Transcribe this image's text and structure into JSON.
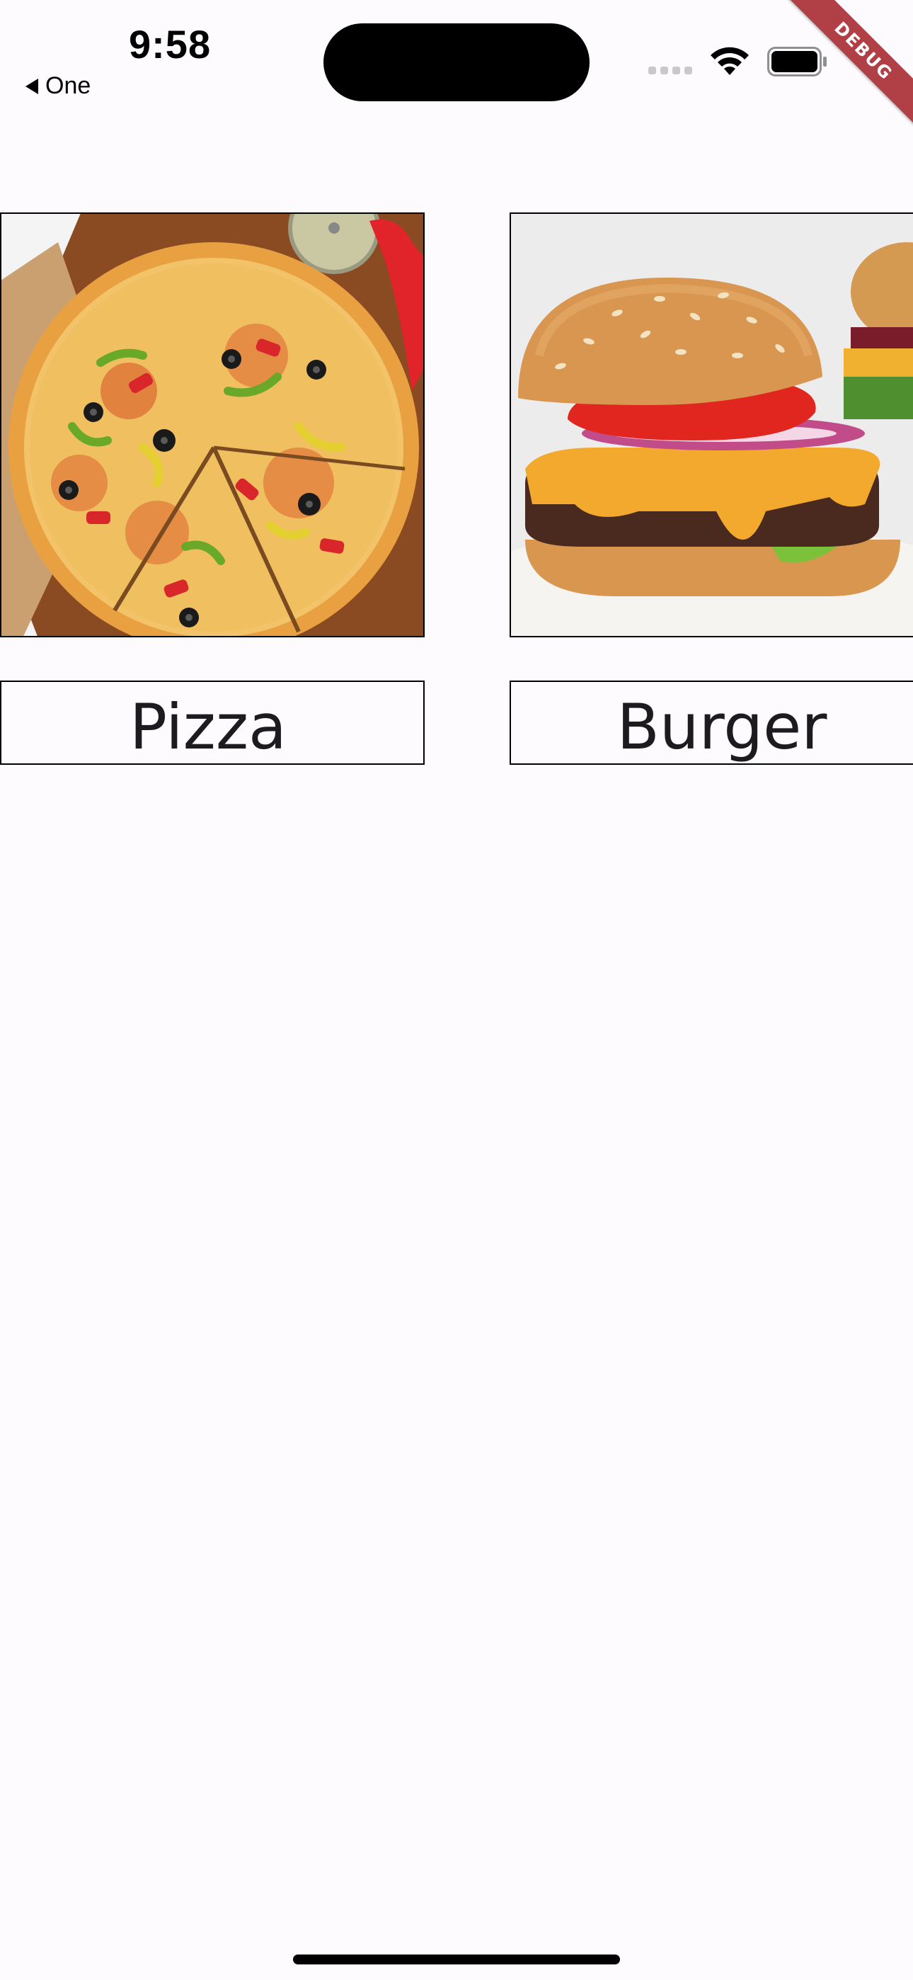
{
  "status_bar": {
    "time": "9:58",
    "back_label": "One"
  },
  "debug_banner": {
    "text": "DEBUG",
    "color": "#b13f46"
  },
  "foods": [
    {
      "label": "Pizza",
      "image": "pizza-photo"
    },
    {
      "label": "Burger",
      "image": "burger-photo"
    }
  ],
  "colors": {
    "background": "#fefbfe",
    "label_text": "#1d1b20",
    "border": "#000000"
  }
}
